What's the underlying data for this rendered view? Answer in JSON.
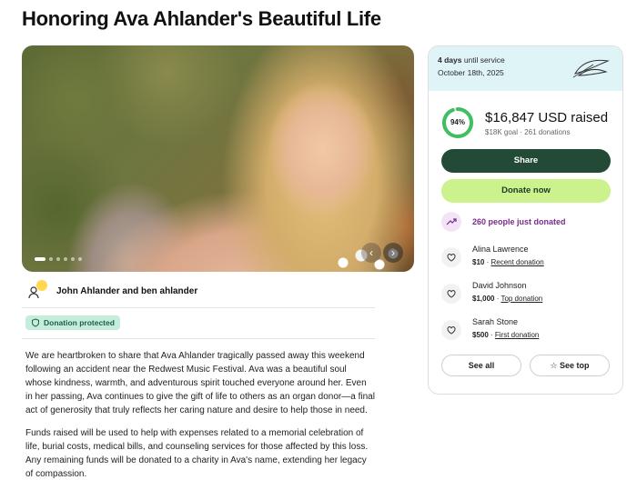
{
  "page": {
    "title": "Honoring Ava Ahlander's Beautiful Life"
  },
  "organizer": {
    "names": "John Ahlander and ben ahlander"
  },
  "badge": {
    "label": "Donation protected"
  },
  "story": {
    "p1": "We are heartbroken to share that Ava Ahlander tragically passed away this weekend following an accident near the Redwest Music Festival. Ava was a beautiful soul whose kindness, warmth, and adventurous spirit touched everyone around her. Even in her passing, Ava continues to give the gift of life to others as an organ donor—a final act of generosity that truly reflects her caring nature and desire to help those in need.",
    "p2": "Funds raised will be used to help with expenses related to a memorial celebration of life, burial costs, medical bills, and counseling services for those affected by this loss. Any remaining funds will be donated to a charity in Ava's name, extending her legacy of compassion."
  },
  "card": {
    "days_bold": "4 days",
    "days_rest": " until service",
    "date": "October 18th, 2025",
    "progress_pct": "94%",
    "progress_fraction": 0.94,
    "raised": "$16,847 USD raised",
    "goal": "$18K goal",
    "separator": "·",
    "donations": "261 donations",
    "share_label": "Share",
    "donate_label": "Donate now",
    "just_donated": "260 people just donated",
    "see_all": "See all",
    "see_top": "See top"
  },
  "donors": [
    {
      "name": "Alina Lawrence",
      "amount": "$10",
      "sep": " · ",
      "tag": "Recent donation"
    },
    {
      "name": "David Johnson",
      "amount": "$1,000",
      "sep": " · ",
      "tag": "Top donation"
    },
    {
      "name": "Sarah Stone",
      "amount": "$500",
      "sep": " · ",
      "tag": "First donation"
    }
  ],
  "colors": {
    "accent_dark": "#234a36",
    "accent_lime": "#cbf28d",
    "progress": "#3fbf5f",
    "protected_bg": "#c4eedb",
    "card_top": "#dff4f6",
    "purple": "#7b2a8c"
  },
  "icons": [
    "user-group-icon",
    "shield-check-icon",
    "leaf-icon",
    "trending-up-icon",
    "heart-hand-icon",
    "star-icon",
    "chevron-left-icon",
    "chevron-right-icon"
  ]
}
